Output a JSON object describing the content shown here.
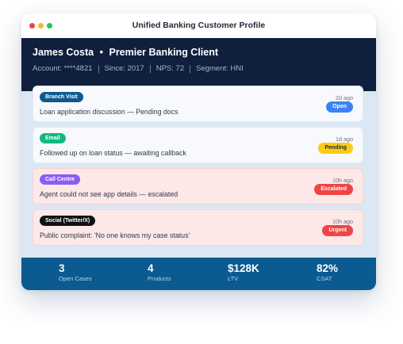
{
  "window": {
    "title": "Unified Banking Customer Profile"
  },
  "customer": {
    "name": "James Costa",
    "separator": "•",
    "tier": "Premier Banking Client",
    "account": "Account: ****4821",
    "since": "Since: 2017",
    "nps": "NPS: 72",
    "segment": "Segment: HNI"
  },
  "interactions": [
    {
      "channel": "Branch Visit",
      "channel_color": "#0b5a91",
      "message": "Loan application discussion — Pending docs",
      "time": "2d ago",
      "status": "Open",
      "status_bg": "#3b82f6",
      "status_fg": "#ffffff"
    },
    {
      "channel": "Email",
      "channel_color": "#10b981",
      "message": "Followed up on loan status — awaiting callback",
      "time": "1d ago",
      "status": "Pending",
      "status_bg": "#facc15",
      "status_fg": "#1f2937"
    },
    {
      "channel": "Call Centre",
      "channel_color": "#8b5cf6",
      "message": "Agent could not see app details — escalated",
      "time": "10h ago",
      "status": "Escalated",
      "status_bg": "#ef4444",
      "status_fg": "#ffffff"
    },
    {
      "channel": "Social (Twitter/X)",
      "channel_color": "#111111",
      "message": "Public complaint: 'No one knows my case status'",
      "time": "10h ago",
      "status": "Urgent",
      "status_bg": "#ef4444",
      "status_fg": "#ffffff"
    }
  ],
  "stats": [
    {
      "value": "3",
      "label": "Open Cases"
    },
    {
      "value": "4",
      "label": "Products"
    },
    {
      "value": "$128K",
      "label": "LTV"
    },
    {
      "value": "82%",
      "label": "CSAT"
    }
  ]
}
